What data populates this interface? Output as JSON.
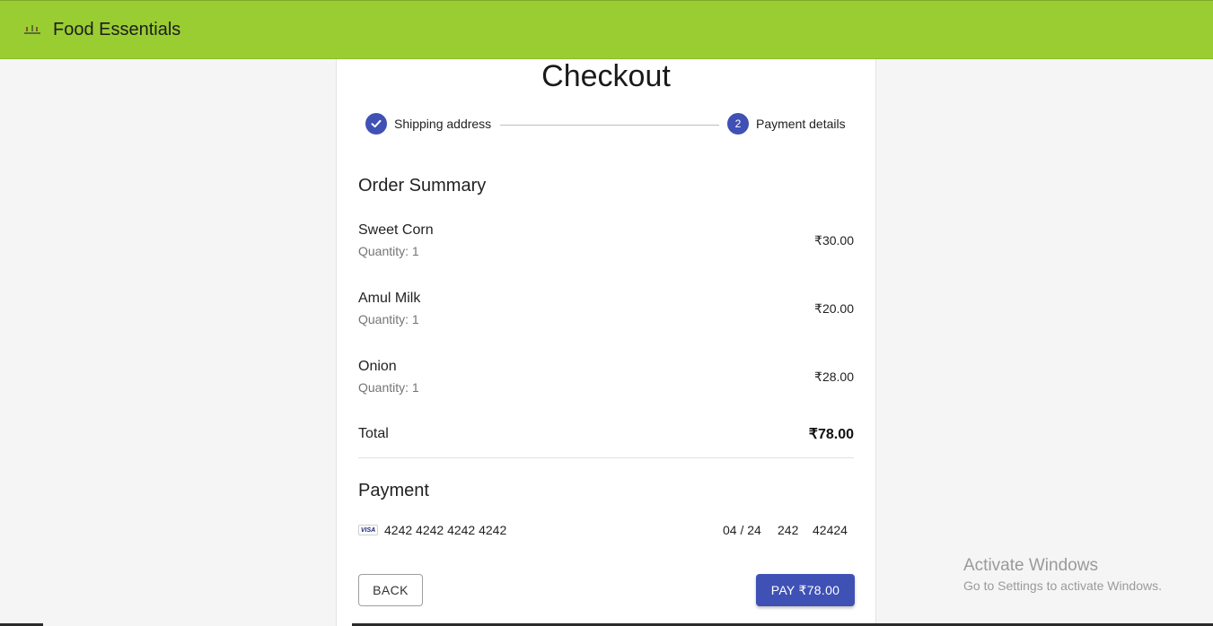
{
  "header": {
    "brand": "Food Essentials",
    "bar_color": "#9acd32"
  },
  "checkout": {
    "title": "Checkout",
    "accent_color": "#3f51b5",
    "steps": [
      {
        "label": "Shipping address",
        "status": "completed",
        "icon": "check-icon"
      },
      {
        "label": "Payment details",
        "status": "active",
        "number": "2"
      }
    ],
    "order_summary": {
      "title": "Order Summary",
      "items": [
        {
          "name": "Sweet Corn",
          "quantity": "Quantity: 1",
          "price": "₹30.00"
        },
        {
          "name": "Amul Milk",
          "quantity": "Quantity: 1",
          "price": "₹20.00"
        },
        {
          "name": "Onion",
          "quantity": "Quantity: 1",
          "price": "₹28.00"
        }
      ],
      "total_label": "Total",
      "total_value": "₹78.00"
    },
    "payment": {
      "title": "Payment",
      "card_brand": "VISA",
      "card_number": "4242 4242 4242 4242",
      "expiry": "04 / 24",
      "cvc": "242",
      "zip": "42424"
    },
    "buttons": {
      "back": "BACK",
      "pay": "PAY ₹78.00"
    }
  },
  "watermark": {
    "title": "Activate Windows",
    "subtitle": "Go to Settings to activate Windows."
  }
}
